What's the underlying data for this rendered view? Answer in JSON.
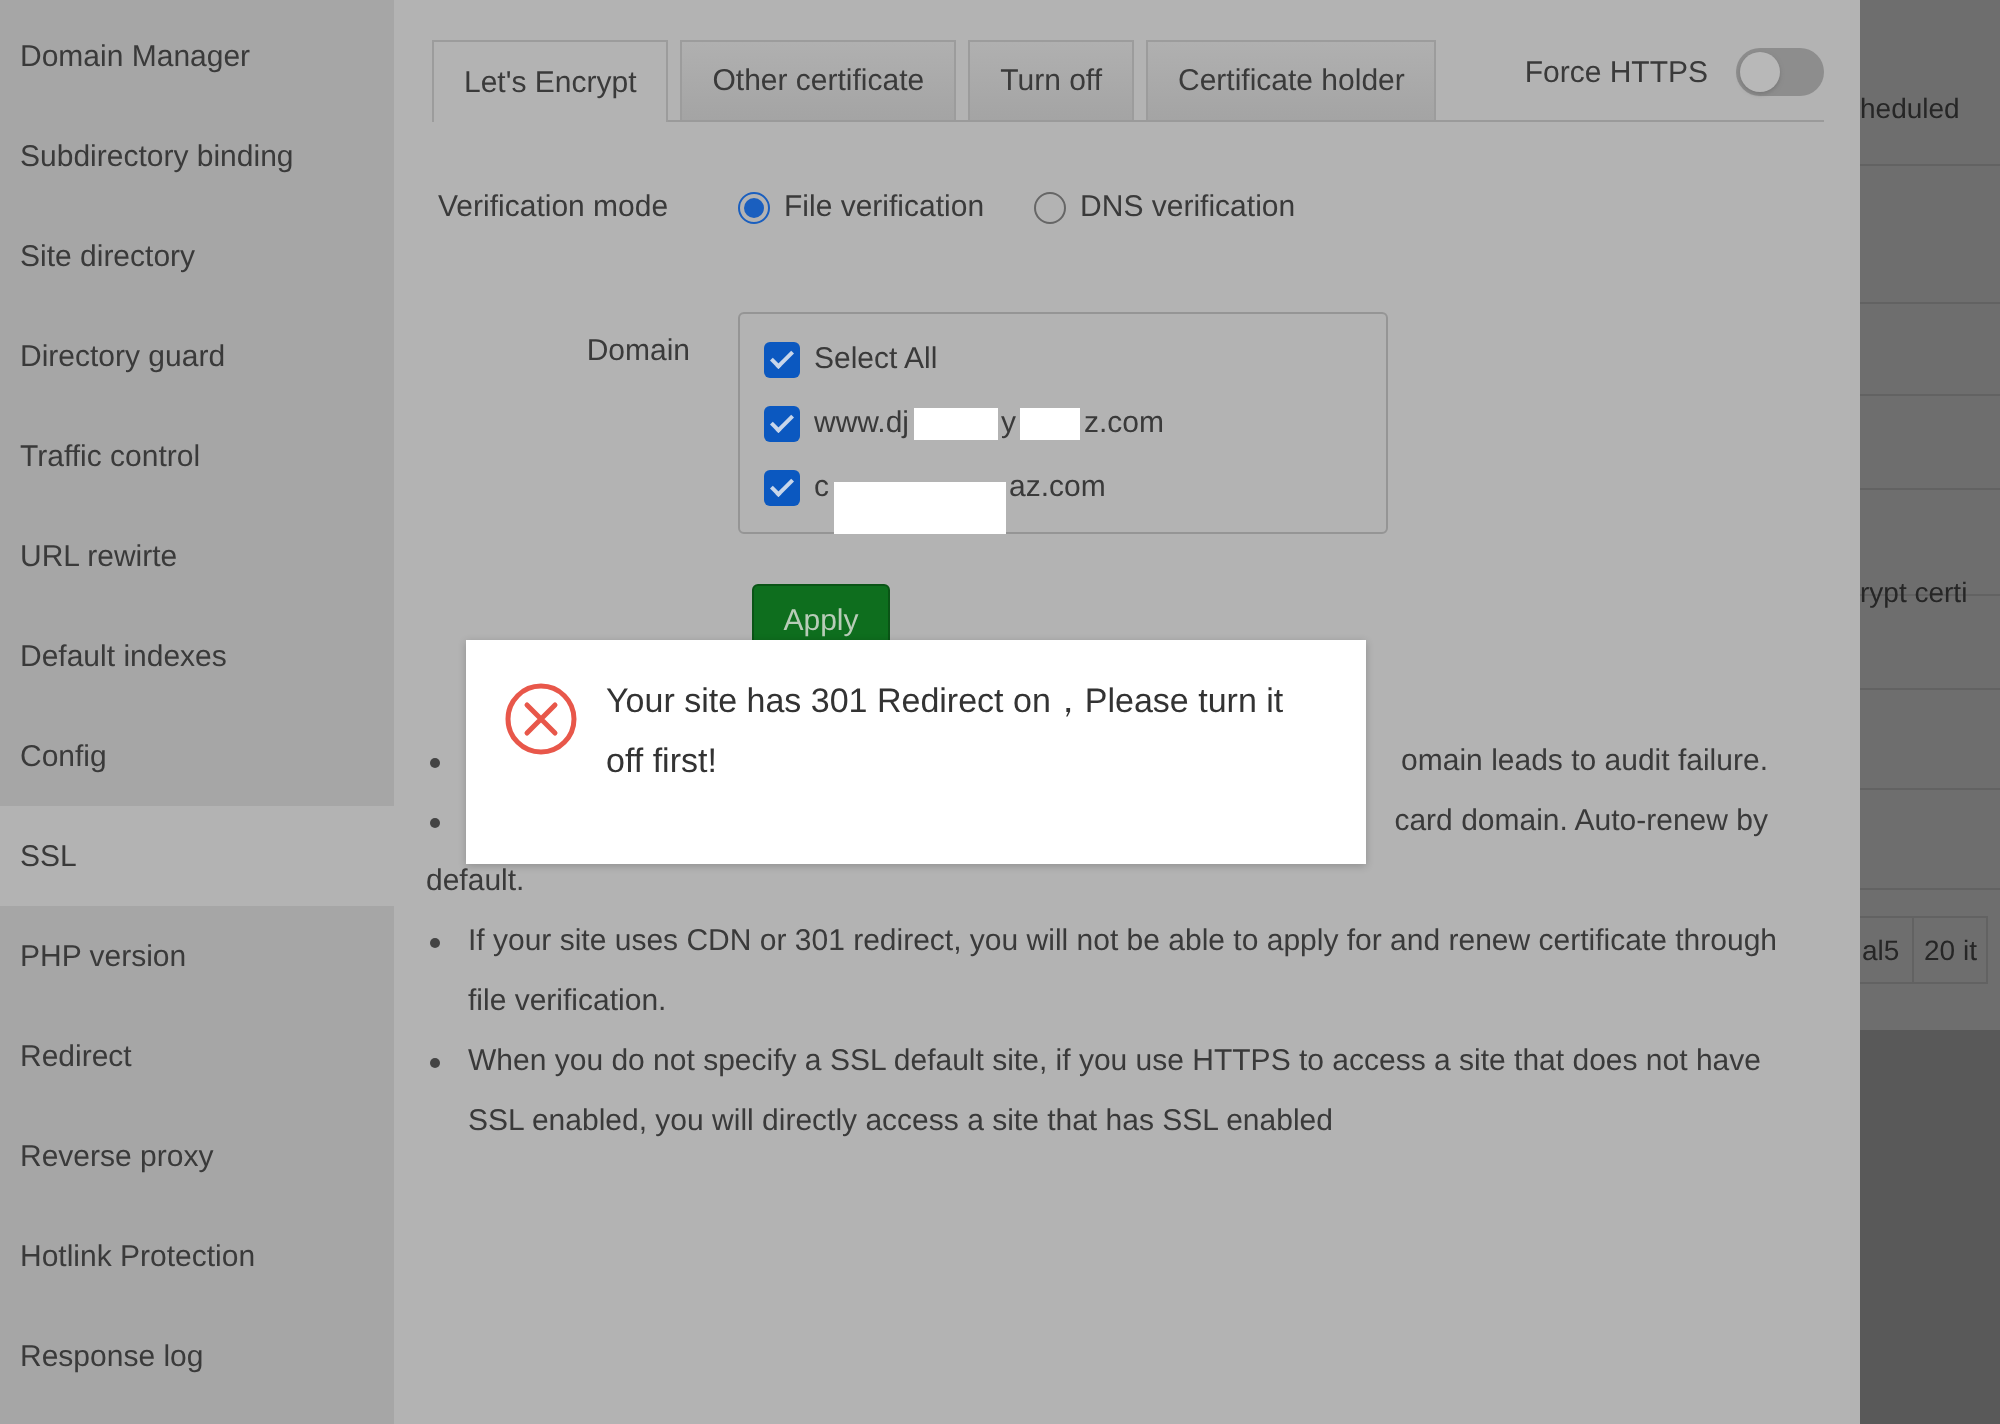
{
  "sidebar": {
    "items": [
      {
        "label": "Domain Manager",
        "selected": false
      },
      {
        "label": "Subdirectory binding",
        "selected": false
      },
      {
        "label": "Site directory",
        "selected": false
      },
      {
        "label": "Directory guard",
        "selected": false
      },
      {
        "label": "Traffic control",
        "selected": false
      },
      {
        "label": "URL rewirte",
        "selected": false
      },
      {
        "label": "Default indexes",
        "selected": false
      },
      {
        "label": "Config",
        "selected": false
      },
      {
        "label": "SSL",
        "selected": true
      },
      {
        "label": "PHP version",
        "selected": false
      },
      {
        "label": "Redirect",
        "selected": false
      },
      {
        "label": "Reverse proxy",
        "selected": false
      },
      {
        "label": "Hotlink Protection",
        "selected": false
      },
      {
        "label": "Response log",
        "selected": false
      }
    ]
  },
  "tabs": [
    {
      "label": "Let's Encrypt",
      "selected": true
    },
    {
      "label": "Other certificate",
      "selected": false
    },
    {
      "label": "Turn off",
      "selected": false
    },
    {
      "label": "Certificate holder",
      "selected": false
    }
  ],
  "force_https": {
    "label": "Force HTTPS",
    "on": false
  },
  "verification_mode": {
    "label": "Verification mode",
    "options": [
      {
        "label": "File verification",
        "selected": true
      },
      {
        "label": "DNS verification",
        "selected": false
      }
    ]
  },
  "domain": {
    "label": "Domain",
    "items": [
      {
        "segments": [
          "Select All"
        ],
        "checked": true
      },
      {
        "segments": [
          "www.dj",
          "y",
          "z.com"
        ],
        "checked": true
      },
      {
        "segments": [
          "c",
          "az.com"
        ],
        "checked": true
      }
    ]
  },
  "apply_button": "Apply",
  "notes": [
    {
      "kind": "covered",
      "lines": [
        "omain leads to audit failure."
      ]
    },
    {
      "kind": "covered",
      "lines": [
        "card domain. Auto-renew by",
        "default."
      ]
    },
    {
      "kind": "full",
      "text": "If your site uses CDN or 301 redirect, you will not be able to apply for and renew certificate through file verification."
    },
    {
      "kind": "full",
      "text": "When you do not specify a SSL default site, if you use HTTPS to access a site that does not have SSL enabled, you will directly access a site that has SSL enabled"
    }
  ],
  "background_page": {
    "texts": [
      "heduled",
      "rypt certi"
    ],
    "cells": [
      "al5",
      "20 it"
    ]
  },
  "alert": {
    "kind": "error",
    "message": "Your site has 301 Redirect on，Please turn it off first!"
  }
}
